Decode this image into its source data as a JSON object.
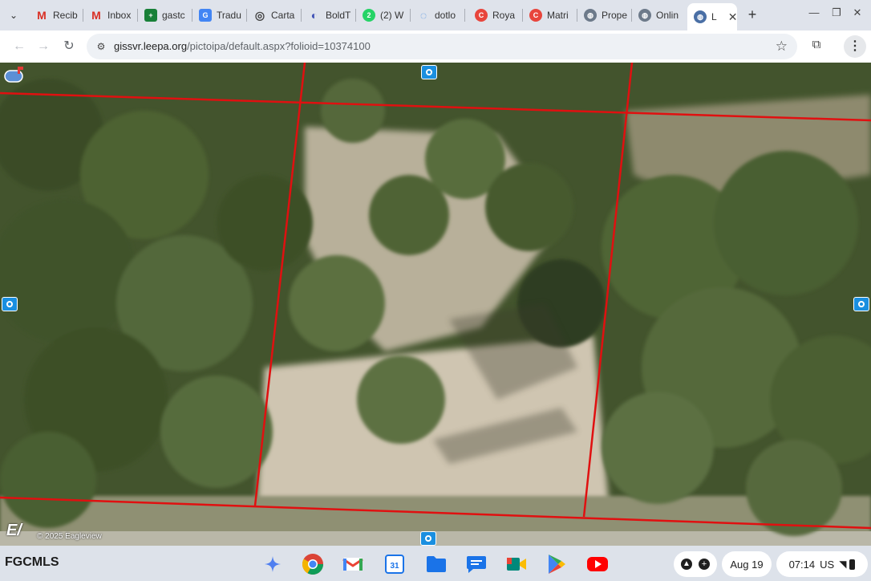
{
  "browser": {
    "tabs": [
      {
        "label": "Recib",
        "favicon": "gmail-icon",
        "color": "#d93025",
        "glyph": "M"
      },
      {
        "label": "Inbox",
        "favicon": "gmail-icon",
        "color": "#d93025",
        "glyph": "M"
      },
      {
        "label": "gastc",
        "favicon": "sheets-icon",
        "color": "#188038",
        "glyph": "+"
      },
      {
        "label": "Tradu",
        "favicon": "translate-icon",
        "color": "#4285f4",
        "glyph": "G"
      },
      {
        "label": "Carta",
        "favicon": "openai-icon",
        "color": "#444444",
        "glyph": "◎"
      },
      {
        "label": "BoldT",
        "favicon": "boldtrail-icon",
        "color": "#3f51b5",
        "glyph": "◐"
      },
      {
        "label": "(2) W",
        "favicon": "whatsapp-icon",
        "color": "#25d366",
        "glyph": "2"
      },
      {
        "label": "dotlo",
        "favicon": "dotloop-icon",
        "color": "#4a90e2",
        "glyph": "◌"
      },
      {
        "label": "Roya",
        "favicon": "royal-icon",
        "color": "#e8453c",
        "glyph": "C"
      },
      {
        "label": "Matri",
        "favicon": "matrix-icon",
        "color": "#e8453c",
        "glyph": "C"
      },
      {
        "label": "Prope",
        "favicon": "globe-icon",
        "color": "#6d7a8a",
        "glyph": "◍"
      },
      {
        "label": "Onlin",
        "favicon": "globe-icon",
        "color": "#6d7a8a",
        "glyph": "◍"
      },
      {
        "label": "L",
        "favicon": "globe-icon",
        "color": "#4a6fa5",
        "glyph": "◍",
        "active": true
      }
    ],
    "url_host": "gissvr.leepa.org",
    "url_path": "/pictoipa/default.aspx?folioid=10374100"
  },
  "map": {
    "copyright": "© 2025 Eagleview",
    "logo_text": "E/"
  },
  "watermark": "FGCMLS",
  "shelf": {
    "apps": [
      {
        "name": "gemini-icon",
        "color": "#4f7ff0"
      },
      {
        "name": "chrome-icon",
        "color": "#db4437"
      },
      {
        "name": "gmail-icon",
        "color": "#ea4335"
      },
      {
        "name": "calendar-icon",
        "color": "#1a73e8"
      },
      {
        "name": "files-icon",
        "color": "#1a73e8"
      },
      {
        "name": "messages-icon",
        "color": "#1a73e8"
      },
      {
        "name": "meet-icon",
        "color": "#00897b"
      },
      {
        "name": "play-store-icon",
        "color": "#34a853"
      },
      {
        "name": "youtube-icon",
        "color": "#ff0000"
      }
    ],
    "calendar_day": "31",
    "date": "Aug 19",
    "time": "07:14",
    "locale": "US"
  }
}
